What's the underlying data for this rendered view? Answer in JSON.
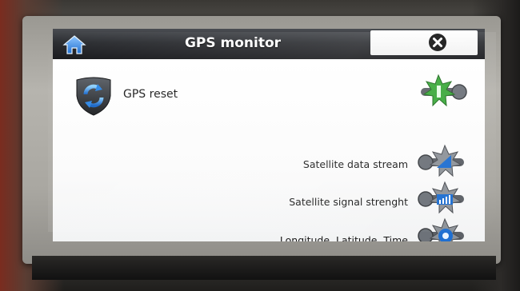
{
  "header": {
    "title": "GPS monitor",
    "home_icon": "home-icon",
    "close_icon": "close-icon"
  },
  "gps_reset": {
    "label": "GPS reset",
    "icon": "refresh-shield-icon",
    "toggle_icon": "green-star-toggle-icon"
  },
  "options": [
    {
      "label": "Satellite data stream",
      "icon": "satellite-stream-icon"
    },
    {
      "label": "Satellite signal strenght",
      "icon": "signal-bars-icon"
    },
    {
      "label": "Longitude, Latitude, Time",
      "icon": "location-icon"
    }
  ],
  "colors": {
    "titlebar": "#2b2d31",
    "accent_blue": "#1f6fd1",
    "accent_green": "#3aa83a"
  }
}
